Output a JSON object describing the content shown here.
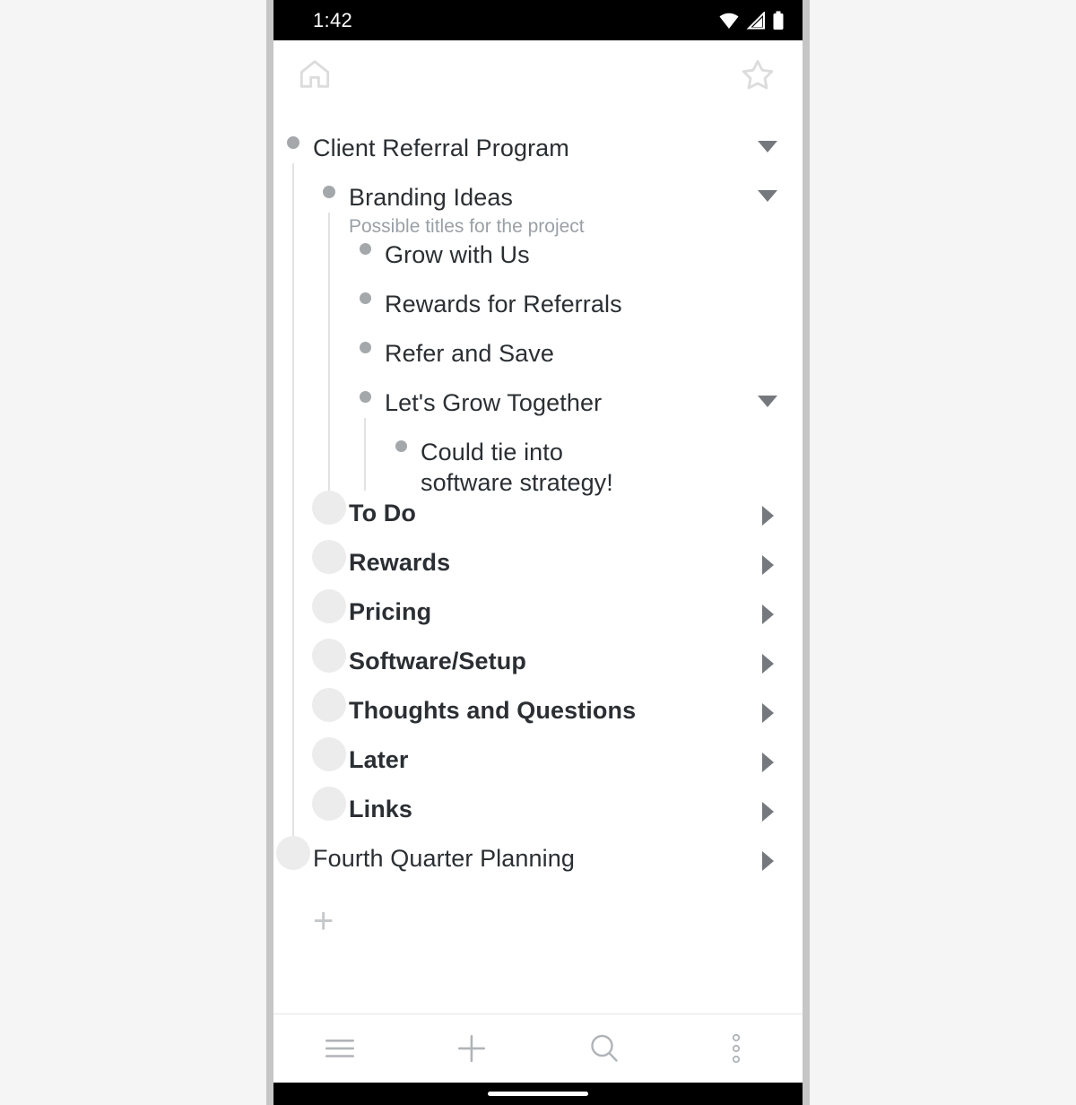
{
  "status_bar": {
    "time": "1:42",
    "icons": [
      "wifi-icon",
      "cellular-signal-icon",
      "battery-icon"
    ]
  },
  "app_bar": {
    "home_icon": "home-icon",
    "star_icon": "star-outline-icon"
  },
  "outline": {
    "items": [
      {
        "id": "client-referral-program",
        "label": "Client Referral Program",
        "note": "",
        "level": 0,
        "bold": false,
        "halo": false,
        "caret": "down"
      },
      {
        "id": "branding-ideas",
        "label": "Branding Ideas",
        "note": "Possible titles for the project",
        "level": 1,
        "bold": false,
        "halo": false,
        "caret": "down"
      },
      {
        "id": "grow-with-us",
        "label": "Grow with Us",
        "note": "",
        "level": 2,
        "bold": false,
        "halo": false,
        "caret": "none"
      },
      {
        "id": "rewards-for-referrals",
        "label": "Rewards for Referrals",
        "note": "",
        "level": 2,
        "bold": false,
        "halo": false,
        "caret": "none"
      },
      {
        "id": "refer-and-save",
        "label": "Refer and Save",
        "note": "",
        "level": 2,
        "bold": false,
        "halo": false,
        "caret": "none"
      },
      {
        "id": "lets-grow-together",
        "label": "Let's Grow Together",
        "note": "",
        "level": 2,
        "bold": false,
        "halo": false,
        "caret": "down"
      },
      {
        "id": "could-tie-into-software-strategy",
        "label": "Could tie into software strategy!",
        "note": "",
        "level": 3,
        "bold": false,
        "halo": false,
        "caret": "none"
      },
      {
        "id": "to-do",
        "label": "To Do",
        "note": "",
        "level": 1,
        "bold": true,
        "halo": true,
        "caret": "right"
      },
      {
        "id": "rewards",
        "label": "Rewards",
        "note": "",
        "level": 1,
        "bold": true,
        "halo": true,
        "caret": "right"
      },
      {
        "id": "pricing",
        "label": "Pricing",
        "note": "",
        "level": 1,
        "bold": true,
        "halo": true,
        "caret": "right"
      },
      {
        "id": "software-setup",
        "label": "Software/Setup",
        "note": "",
        "level": 1,
        "bold": true,
        "halo": true,
        "caret": "right"
      },
      {
        "id": "thoughts-and-questions",
        "label": "Thoughts and Questions",
        "note": "",
        "level": 1,
        "bold": true,
        "halo": true,
        "caret": "right"
      },
      {
        "id": "later",
        "label": "Later",
        "note": "",
        "level": 1,
        "bold": true,
        "halo": true,
        "caret": "right"
      },
      {
        "id": "links",
        "label": "Links",
        "note": "",
        "level": 1,
        "bold": true,
        "halo": true,
        "caret": "right"
      },
      {
        "id": "fourth-quarter-planning",
        "label": "Fourth Quarter Planning",
        "note": "",
        "level": 0,
        "bold": false,
        "halo": true,
        "caret": "right"
      }
    ],
    "add_button_label": "+"
  },
  "bottom_nav": {
    "items": [
      {
        "id": "menu",
        "icon": "hamburger-menu-icon"
      },
      {
        "id": "add",
        "icon": "plus-icon"
      },
      {
        "id": "search",
        "icon": "search-icon"
      },
      {
        "id": "more",
        "icon": "overflow-menu-icon"
      }
    ]
  },
  "colors": {
    "bullet": "#a4a8ab",
    "halo": "#ececec",
    "caret": "#75797d",
    "text": "#2b2f33",
    "note": "#9aa0a6",
    "guide": "#e2e2e2",
    "nav_icon": "#b0b4b8",
    "frame": "#c6c6c6",
    "status_bar_bg": "#000000",
    "page_bg": "#f5f5f5"
  }
}
